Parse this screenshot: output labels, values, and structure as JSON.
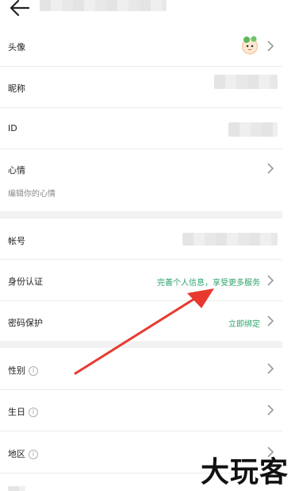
{
  "rows": {
    "avatar": {
      "label": "头像"
    },
    "nickname": {
      "label": "昵称"
    },
    "id": {
      "label": "ID"
    },
    "mood": {
      "label": "心情",
      "sub": "编辑你的心情"
    },
    "account": {
      "label": "帐号"
    },
    "identity": {
      "label": "身份认证",
      "value": "完善个人信息，享受更多服务"
    },
    "password": {
      "label": "密码保护",
      "value": "立即绑定"
    },
    "gender": {
      "label": "性别"
    },
    "birthday": {
      "label": "生日"
    },
    "region": {
      "label": "地区"
    }
  },
  "info_glyph": "i",
  "watermark": "大玩客",
  "colors": {
    "accent_green": "#2aa36b",
    "arrow_red": "#e8392f",
    "divider": "#ececec",
    "section_gap": "#f2f2f2"
  }
}
